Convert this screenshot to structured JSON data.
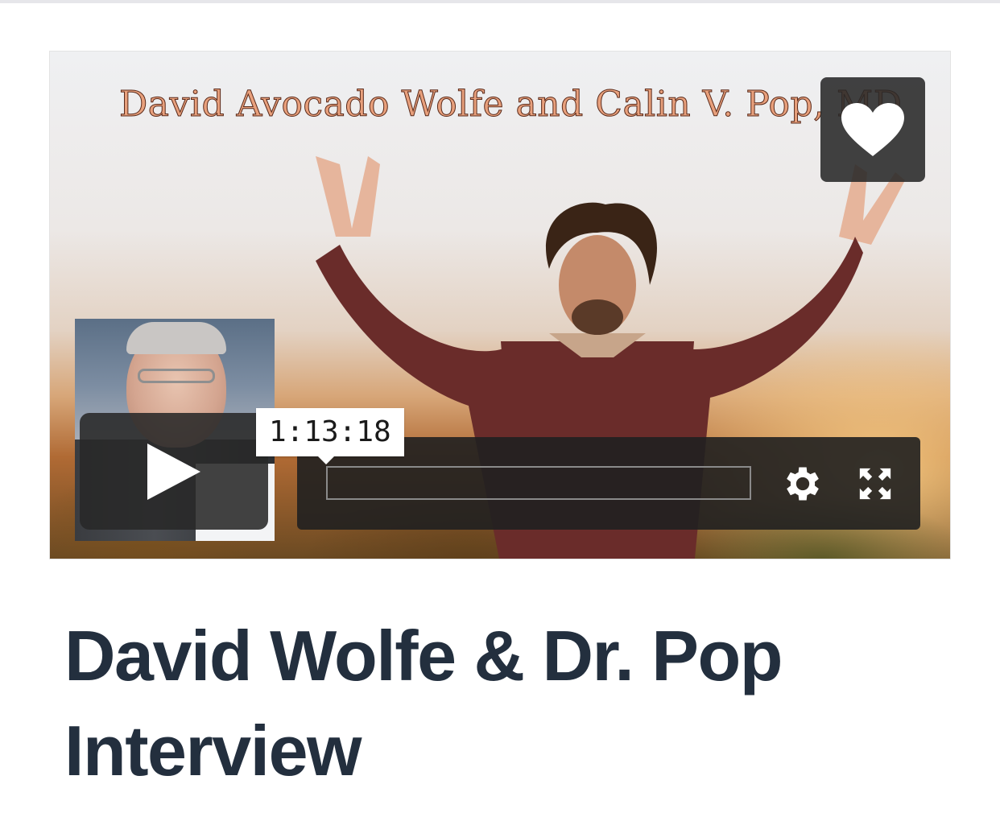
{
  "video": {
    "caption_overlay": "David Avocado Wolfe and Calin V. Pop, MD",
    "hover_time": "1:13:18",
    "progress_fraction": 0.0
  },
  "controls": {
    "like_icon": "heart-icon",
    "play_icon": "play-icon",
    "settings_icon": "gear-icon",
    "fullscreen_icon": "fullscreen-icon"
  },
  "page": {
    "title": "David Wolfe & Dr. Pop Interview"
  },
  "colors": {
    "title": "#232f3e",
    "control_background": "#202020",
    "tooltip_background": "#ffffff"
  }
}
